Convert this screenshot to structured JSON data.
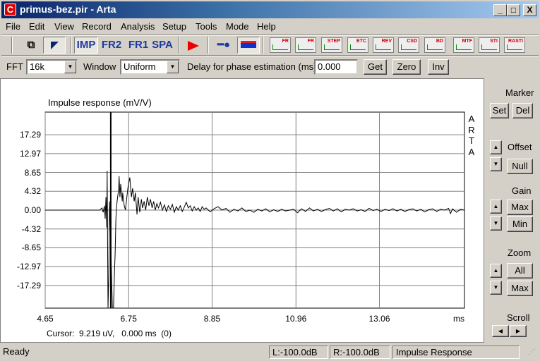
{
  "window": {
    "title": "primus-bez.pir - Arta",
    "minimize": "_",
    "maximize": "□",
    "close": "X",
    "app_icon": "C"
  },
  "menu": [
    "File",
    "Edit",
    "View",
    "Record",
    "Analysis",
    "Setup",
    "Tools",
    "Mode",
    "Help"
  ],
  "toolbar": {
    "modes": [
      "IMP",
      "FR2",
      "FR1",
      "SPA"
    ],
    "analysis_icons": [
      "FR",
      "FR",
      "STEP",
      "ETC",
      "REV",
      "CSD",
      "BD",
      "MTF",
      "STI",
      "RASTI"
    ]
  },
  "controls": {
    "fft_label": "FFT",
    "fft_value": "16k",
    "window_label": "Window",
    "window_value": "Uniform",
    "delay_label": "Delay for phase estimation (ms)",
    "delay_value": "0.000",
    "get": "Get",
    "zero": "Zero",
    "inv": "Inv"
  },
  "side": {
    "marker": "Marker",
    "set": "Set",
    "del": "Del",
    "offset": "Offset",
    "null": "Null",
    "gain": "Gain",
    "gain_max": "Max",
    "gain_min": "Min",
    "zoom": "Zoom",
    "zoom_all": "All",
    "zoom_max": "Max",
    "scroll": "Scroll"
  },
  "cursor_text": "Cursor:  9.219 uV,   0.000 ms  (0)",
  "status": {
    "ready": "Ready",
    "left": "L:-100.0dB",
    "right": "R:-100.0dB",
    "mode": "Impulse Response"
  },
  "chart_data": {
    "type": "line",
    "title": "Impulse response (mV/V)",
    "watermark": [
      "A",
      "R",
      "T",
      "A"
    ],
    "xlabel": "ms",
    "xlim": [
      4.65,
      15.2
    ],
    "ylim": [
      -22.5,
      22.5
    ],
    "xticks": [
      "4.65",
      "6.75",
      "8.85",
      "10.96",
      "13.06"
    ],
    "xtick_values": [
      4.65,
      6.75,
      8.85,
      10.96,
      13.06
    ],
    "yticks": [
      "17.29",
      "12.97",
      "8.65",
      "4.32",
      "0.00",
      "-4.32",
      "-8.65",
      "-12.97",
      "-17.29"
    ],
    "ytick_values": [
      17.29,
      12.97,
      8.65,
      4.32,
      0,
      -4.32,
      -8.65,
      -12.97,
      -17.29
    ],
    "grid": true,
    "cursor_x": 6.3,
    "series": [
      {
        "name": "impulse",
        "points": [
          [
            4.65,
            0
          ],
          [
            6.02,
            0
          ],
          [
            6.08,
            0.5
          ],
          [
            6.11,
            -0.5
          ],
          [
            6.14,
            1
          ],
          [
            6.16,
            -2
          ],
          [
            6.18,
            3
          ],
          [
            6.2,
            -4
          ],
          [
            6.21,
            9
          ],
          [
            6.23,
            -22.5
          ],
          [
            6.25,
            -15
          ],
          [
            6.27,
            2
          ],
          [
            6.3,
            -8
          ],
          [
            6.34,
            -22.5
          ],
          [
            6.37,
            -22.5
          ],
          [
            6.39,
            -15
          ],
          [
            6.41,
            -10
          ],
          [
            6.43,
            -2
          ],
          [
            6.44,
            0
          ],
          [
            6.46,
            2
          ],
          [
            6.5,
            5
          ],
          [
            6.51,
            7.8
          ],
          [
            6.53,
            3
          ],
          [
            6.55,
            6
          ],
          [
            6.59,
            2
          ],
          [
            6.6,
            4
          ],
          [
            6.64,
            1
          ],
          [
            6.67,
            0
          ],
          [
            6.73,
            5
          ],
          [
            6.78,
            7.5
          ],
          [
            6.82,
            3
          ],
          [
            6.85,
            5
          ],
          [
            6.89,
            2
          ],
          [
            6.92,
            4
          ],
          [
            6.96,
            -1
          ],
          [
            6.99,
            3
          ],
          [
            7.03,
            -0.5
          ],
          [
            7.07,
            2.5
          ],
          [
            7.1,
            0.5
          ],
          [
            7.14,
            2
          ],
          [
            7.18,
            0
          ],
          [
            7.22,
            3
          ],
          [
            7.26,
            1
          ],
          [
            7.3,
            2.5
          ],
          [
            7.34,
            0.5
          ],
          [
            7.38,
            2
          ],
          [
            7.42,
            0
          ],
          [
            7.46,
            1.5
          ],
          [
            7.5,
            0.5
          ],
          [
            7.55,
            1.8
          ],
          [
            7.6,
            0
          ],
          [
            7.65,
            1.2
          ],
          [
            7.7,
            -0.3
          ],
          [
            7.75,
            1
          ],
          [
            7.8,
            0.2
          ],
          [
            7.85,
            1.3
          ],
          [
            7.9,
            -0.5
          ],
          [
            7.95,
            0.8
          ],
          [
            8.0,
            0
          ],
          [
            8.05,
            1
          ],
          [
            8.1,
            -0.3
          ],
          [
            8.15,
            0.7
          ],
          [
            8.2,
            1.8
          ],
          [
            8.25,
            0.5
          ],
          [
            8.3,
            1
          ],
          [
            8.35,
            -0.2
          ],
          [
            8.4,
            0.8
          ],
          [
            8.45,
            0
          ],
          [
            8.5,
            0.5
          ],
          [
            8.55,
            -0.3
          ],
          [
            8.6,
            0.8
          ],
          [
            8.65,
            0.2
          ],
          [
            8.7,
            0.5
          ],
          [
            8.8,
            -0.4
          ],
          [
            8.9,
            0.3
          ],
          [
            9.0,
            0.8
          ],
          [
            9.1,
            0
          ],
          [
            9.2,
            0.4
          ],
          [
            9.3,
            -0.5
          ],
          [
            9.4,
            0.2
          ],
          [
            9.5,
            -0.2
          ],
          [
            9.6,
            0.5
          ],
          [
            9.7,
            -0.3
          ],
          [
            9.8,
            0
          ],
          [
            9.9,
            -0.5
          ],
          [
            10.0,
            0.2
          ],
          [
            10.1,
            -0.2
          ],
          [
            10.2,
            0.3
          ],
          [
            10.3,
            -0.4
          ],
          [
            10.4,
            0.1
          ],
          [
            10.5,
            -0.3
          ],
          [
            10.6,
            0.2
          ],
          [
            10.7,
            -0.2
          ],
          [
            10.8,
            0
          ],
          [
            10.9,
            0.2
          ],
          [
            11.0,
            -0.6
          ],
          [
            11.1,
            0.3
          ],
          [
            11.2,
            -0.3
          ],
          [
            11.3,
            0.5
          ],
          [
            11.4,
            -0.2
          ],
          [
            11.5,
            0.2
          ],
          [
            11.6,
            -0.3
          ],
          [
            11.7,
            0.1
          ],
          [
            11.8,
            0.4
          ],
          [
            11.9,
            -0.2
          ],
          [
            12.0,
            0.3
          ],
          [
            12.1,
            -0.4
          ],
          [
            12.2,
            0.2
          ],
          [
            12.3,
            0
          ],
          [
            12.4,
            0.3
          ],
          [
            12.5,
            -0.2
          ],
          [
            12.6,
            0.1
          ],
          [
            12.7,
            -0.3
          ],
          [
            12.8,
            0.4
          ],
          [
            12.9,
            -0.1
          ],
          [
            13.0,
            0.2
          ],
          [
            13.1,
            -0.3
          ],
          [
            13.2,
            0.2
          ],
          [
            13.3,
            -0.1
          ],
          [
            13.4,
            0.3
          ],
          [
            13.5,
            -0.2
          ],
          [
            13.6,
            0.2
          ],
          [
            13.7,
            -0.3
          ],
          [
            13.8,
            0.1
          ],
          [
            13.9,
            0.3
          ],
          [
            14.0,
            -0.2
          ],
          [
            14.1,
            0.2
          ],
          [
            14.2,
            -0.4
          ],
          [
            14.3,
            0.1
          ],
          [
            14.4,
            0.3
          ],
          [
            14.5,
            -0.3
          ],
          [
            14.6,
            0.2
          ],
          [
            14.7,
            0
          ],
          [
            14.8,
            0.4
          ],
          [
            14.85,
            -0.8
          ],
          [
            14.9,
            0.3
          ],
          [
            15.0,
            -0.5
          ],
          [
            15.1,
            0.2
          ],
          [
            15.2,
            0
          ]
        ]
      }
    ]
  }
}
